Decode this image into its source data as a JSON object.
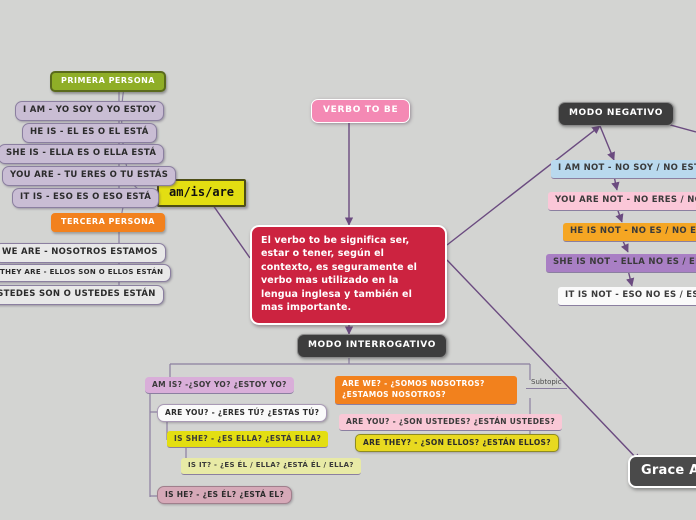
{
  "background_color": "#d3d4d2",
  "connector_color": "#6b4b80",
  "center": {
    "root_label": "VERBO TO BE",
    "description": "El verbo to be significa ser, estar o tener, según el contexto, es seguramente el verbo mas utilizado en la lengua inglesa y también el mas importante.",
    "aux_label": "am/is/are"
  },
  "persons": {
    "primera_label": "PRIMERA PERSONA",
    "tercera_label": "TERCERA PERSONA",
    "primera_items": [
      "I AM - YO SOY O YO ESTOY",
      "HE IS - EL ES O EL ESTÁ",
      "SHE IS - ELLA ES O ELLA ESTÁ",
      "YOU ARE - TU ERES O TU ESTÁS",
      "IT IS - ESO ES O ESO ESTÁ"
    ],
    "tercera_items": [
      "WE ARE - NOSOTROS ESTAMOS",
      "THEY ARE - ELLOS SON O ELLOS ESTÁN",
      "USTEDES SON O USTEDES ESTÁN"
    ]
  },
  "negativo": {
    "label": "MODO NEGATIVO",
    "items": [
      "I AM NOT - NO SOY / NO ESTOY",
      "YOU ARE NOT - NO ERES / NO ESTÁS",
      "HE IS NOT - NO ES / NO ESTÁ",
      "SHE IS NOT - ELLA NO ES / ELLA NO ESTÁ",
      "IT IS NOT - ESO NO ES / ESO NO ESTÁ"
    ]
  },
  "interrogativo": {
    "label": "MODO INTERROGATIVO",
    "left_items": [
      "AM IS?  -¿SOY YO? ¿ESTOY YO?",
      "ARE YOU? - ¿ERES TÚ? ¿ESTAS TÚ?",
      "IS SHE? - ¿ES ELLA? ¿ESTÁ ELLA?",
      "IS IT? - ¿ES ÉL / ELLA? ¿ESTÁ ÉL / ELLA?",
      "IS HE? - ¿ES ÉL? ¿ESTÁ EL?"
    ],
    "right_items": [
      "ARE WE? - ¿SOMOS NOSOTROS? ¿ESTAMOS NOSOTROS?",
      "ARE YOU? - ¿SON USTEDES? ¿ESTÁN USTEDES?",
      "ARE THEY? - ¿SON ELLOS? ¿ESTÁN ELLOS?"
    ],
    "subtopic_label": "Subtopic"
  },
  "author": {
    "name": "Grace Agu"
  }
}
